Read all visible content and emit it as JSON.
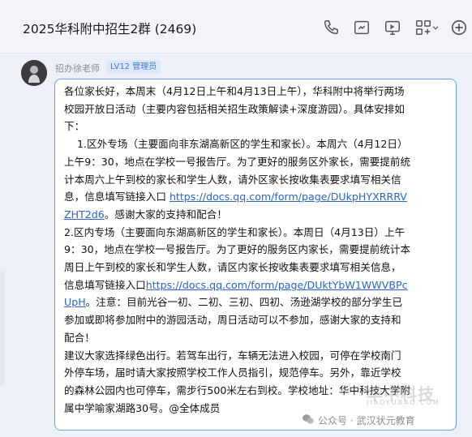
{
  "header": {
    "title": "2025华科附中招生2群 (2469)"
  },
  "toolbar": {
    "icons": [
      "phone-icon",
      "video-icon",
      "screen-share-icon",
      "apps-icon",
      "chevron-down-icon",
      "add-icon"
    ]
  },
  "message": {
    "sender": "招办徐老师",
    "badge": "LV12 管理员",
    "lines": [
      "各位家长好，本周末（4月12日上午和4月13日上午），华科附中将举行两场",
      "校园开放日活动（主要内容包括相关招生政策解读+深度游园）。具体安排如",
      "下：",
      "    1.区外专场（主要面向非东湖高新区的学生和家长）。本周六（4月12日）",
      "上午9：30，地点在学校一号报告厅。为了更好的服务区外家长，需要提前统",
      "计本周六上午到校的家长和学生人数，请外区家长按收集表要求填写相关信",
      "息，信息填写链接入口 ",
      "。感谢大家的支持和配合！",
      "2.区内专场（主要面向东湖高新区的学生和家长）。本周日（4月13日）上午",
      "9：30，地点在学校一号报告厅。为了更好的服务区内家长，需要提前统计本",
      "周日上午到校的家长和学生人数，请区内家长按收集表要求填写相关信息，",
      "信息填写链接入口",
      "。注意：目前光谷一初、二初、三初、四初、汤逊湖学校的部分学生已",
      "参加或即将参加附中的游园活动，周日活动可以不参加，感谢大家的支持和",
      "配合！",
      "建议大家选择绿色出行。若驾车出行，车辆无法进入校园，可停在学校南门",
      "外停车场，届时请大家按照学校工作人员指引，规范停车。另外，靠近学校",
      "的森林公园内也可停车，需步行500米左右到校。学校地址：华中科技大学附",
      "属中学喻家湖路30号。@全体成员"
    ],
    "link1": {
      "part1": "https://docs.qq.com/form/page/DUkpHYXRRRV",
      "part2": "ZHT2d6"
    },
    "link2": {
      "part1": "https://docs.qq.com/form/page/DUktYbW1WWVBPc",
      "part2": "UpH"
    }
  },
  "watermark": {
    "main": "华中科技",
    "sub": "JIAOYUBAO.COM",
    "bottom_prefix": "公众号 · ",
    "bottom_name": "武汉状元教育"
  },
  "colors": {
    "accent": "#6d9ff0",
    "link": "#2a64c7",
    "badge_bg": "#dde9fb",
    "badge_text": "#3b7ae0"
  }
}
